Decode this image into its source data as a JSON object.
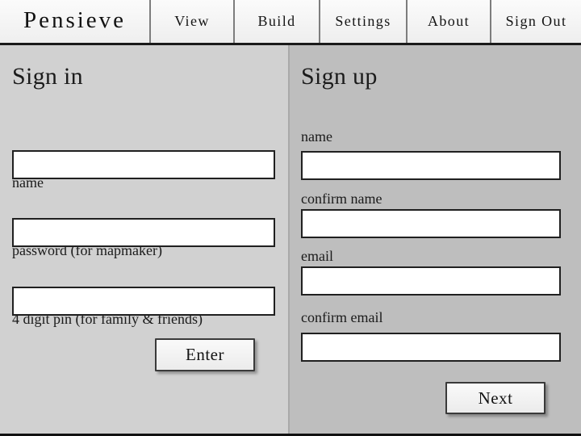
{
  "app": {
    "brand": "Pensieve"
  },
  "nav": {
    "items": [
      {
        "label": "View"
      },
      {
        "label": "Build"
      },
      {
        "label": "Settings"
      },
      {
        "label": "About"
      },
      {
        "label": "Sign Out"
      }
    ]
  },
  "signin": {
    "title": "Sign in",
    "fields": [
      {
        "label": "name",
        "value": "",
        "placeholder": ""
      },
      {
        "label": "password (for mapmaker)",
        "value": "",
        "placeholder": ""
      },
      {
        "label": "4 digit pin (for family & friends)",
        "value": "",
        "placeholder": ""
      }
    ],
    "submit_label": "Enter"
  },
  "signup": {
    "title": "Sign up",
    "fields": [
      {
        "label": "name",
        "value": "",
        "placeholder": ""
      },
      {
        "label": "confirm name",
        "value": "",
        "placeholder": ""
      },
      {
        "label": "email",
        "value": "",
        "placeholder": ""
      },
      {
        "label": "confirm email",
        "value": "",
        "placeholder": ""
      }
    ],
    "submit_label": "Next"
  },
  "colors": {
    "panel_left_bg": "#d1d1d1",
    "panel_right_bg": "#bebebe",
    "navbar_bg": "#f2f2f2",
    "text": "#1b1b1b",
    "input_bg": "#ffffff",
    "input_border": "#202020",
    "divider": "#a9a9a9"
  }
}
